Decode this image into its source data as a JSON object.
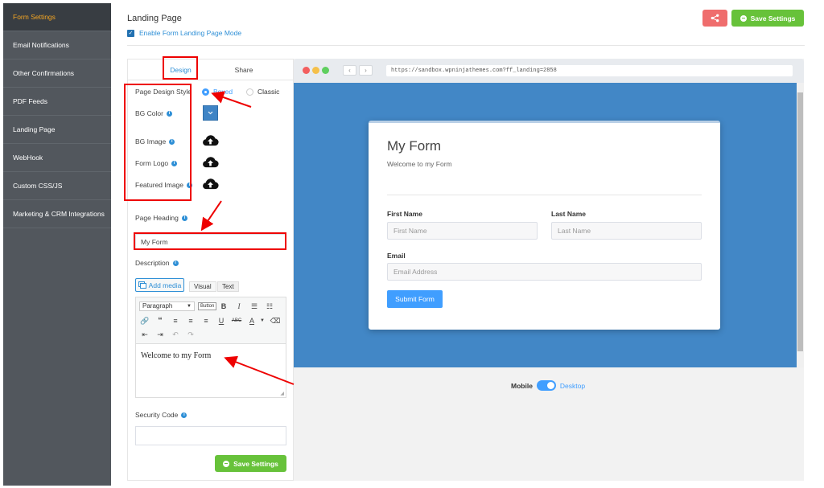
{
  "sidebar": {
    "items": [
      {
        "label": "Form Settings",
        "active": true
      },
      {
        "label": "Email Notifications"
      },
      {
        "label": "Other Confirmations"
      },
      {
        "label": "PDF Feeds"
      },
      {
        "label": "Landing Page"
      },
      {
        "label": "WebHook"
      },
      {
        "label": "Custom CSS/JS"
      },
      {
        "label": "Marketing & CRM Integrations"
      }
    ]
  },
  "header": {
    "title": "Landing Page",
    "enable_label": "Enable Form Landing Page Mode",
    "enable_checked": true,
    "share_icon": "share-icon",
    "save_label": "Save Settings"
  },
  "tabs": {
    "design": "Design",
    "share": "Share"
  },
  "design": {
    "page_style_label": "Page Design Style",
    "style_boxed": "Boxed",
    "style_classic": "Classic",
    "selected_style": "Boxed",
    "bg_color_label": "BG Color",
    "bg_color_value": "#3f84c5",
    "bg_image_label": "BG Image",
    "form_logo_label": "Form Logo",
    "featured_image_label": "Featured Image",
    "upload_icon": "cloud-upload-icon",
    "page_heading_label": "Page Heading",
    "page_heading_value": "My Form",
    "description_label": "Description",
    "add_media": "Add media",
    "editor_tab_visual": "Visual",
    "editor_tab_text": "Text",
    "paragraph_select": "Paragraph",
    "button_tool": "Button",
    "description_value": "Welcome to my Form",
    "security_code_label": "Security Code",
    "security_code_value": "",
    "save_label": "Save Settings"
  },
  "browser": {
    "url": "https://sandbox.wpninjathemes.com?ff_landing=2858",
    "back_icon": "chevron-left-icon",
    "forward_icon": "chevron-right-icon"
  },
  "preview": {
    "form_title": "My Form",
    "form_description": "Welcome to my Form",
    "first_name_label": "First Name",
    "first_name_placeholder": "First Name",
    "last_name_label": "Last Name",
    "last_name_placeholder": "Last Name",
    "email_label": "Email",
    "email_placeholder": "Email Address",
    "submit_label": "Submit Form",
    "background_color": "#4287c6"
  },
  "device_toggle": {
    "mobile": "Mobile",
    "desktop": "Desktop",
    "selected": "Desktop"
  },
  "colors": {
    "accent": "#409eff",
    "success": "#67c23a",
    "danger": "#ef6d6d",
    "annotation": "#e00000"
  }
}
